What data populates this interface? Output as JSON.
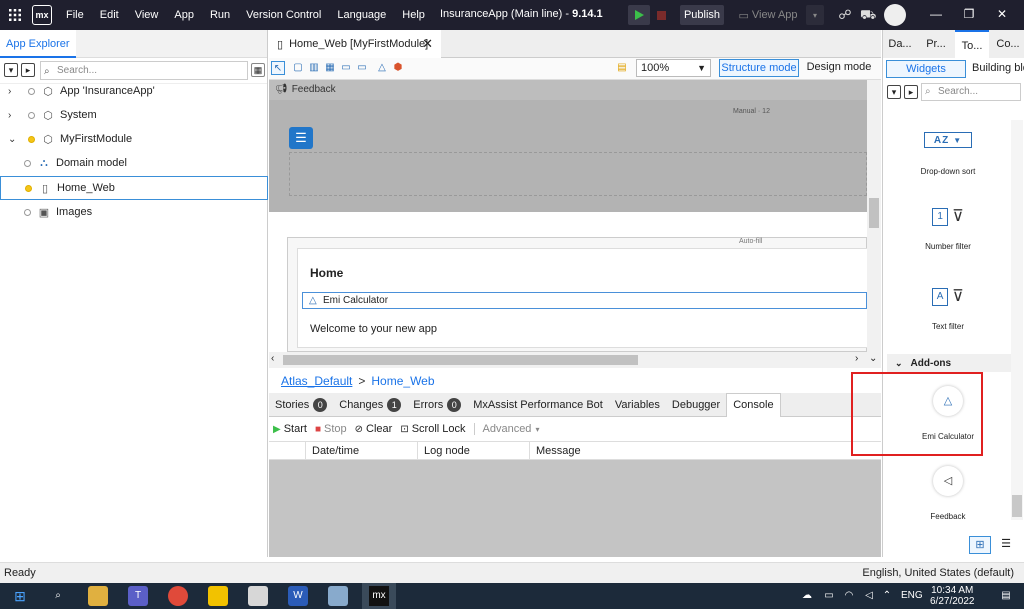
{
  "topbar": {
    "menu": [
      "File",
      "Edit",
      "View",
      "App",
      "Run",
      "Version Control",
      "Language",
      "Help"
    ],
    "app_name": "InsuranceApp (Main line)",
    "version": "9.14.1",
    "publish_label": "Publish",
    "view_app_label": "View App",
    "logo_text": "mx"
  },
  "left_panel": {
    "tab_label": "App Explorer",
    "search_placeholder": "Search...",
    "tree": [
      {
        "label": "App 'InsuranceApp'",
        "expandable": true
      },
      {
        "label": "System",
        "expandable": true
      },
      {
        "label": "MyFirstModule",
        "expandable": true,
        "expanded": true
      },
      {
        "label": "Domain model"
      },
      {
        "label": "Home_Web",
        "selected": true
      },
      {
        "label": "Images"
      }
    ]
  },
  "document": {
    "tab_label": "Home_Web [MyFirstModule]",
    "zoom": "100%",
    "structure_mode_label": "Structure mode",
    "design_mode_label": "Design mode",
    "feedback_label": "Feedback",
    "manual_label": "Manual · 12",
    "autofill_label": "Auto-fill",
    "home_title": "Home",
    "emi_label": "Emi Calculator",
    "welcome_text": "Welcome to your new app",
    "breadcrumb": [
      "Atlas_Default",
      "Home_Web"
    ],
    "breadcrumb_sep": ">"
  },
  "bottom_panel": {
    "tabs": [
      {
        "label": "Stories",
        "badge": "0"
      },
      {
        "label": "Changes",
        "badge": "1"
      },
      {
        "label": "Errors",
        "badge": "0"
      },
      {
        "label": "MxAssist Performance Bot"
      },
      {
        "label": "Variables"
      },
      {
        "label": "Debugger"
      },
      {
        "label": "Console",
        "active": true
      }
    ],
    "tools": {
      "start": "Start",
      "stop": "Stop",
      "clear": "Clear",
      "scroll_lock": "Scroll Lock",
      "advanced": "Advanced"
    },
    "columns": [
      "Date/time",
      "Log node",
      "Message"
    ]
  },
  "right_panel": {
    "tabs": [
      "Da...",
      "Pr...",
      "To...",
      "Co..."
    ],
    "widgets_label": "Widgets",
    "building_label": "Building blo",
    "search_placeholder": "Search...",
    "widgets": [
      {
        "label": "Drop-down sort",
        "icon": "AZ"
      },
      {
        "label": "Number filter",
        "icon": "1"
      },
      {
        "label": "Text filter",
        "icon": "A"
      }
    ],
    "addons_label": "Add-ons",
    "addons": [
      {
        "label": "Emi Calculator"
      },
      {
        "label": "Feedback"
      }
    ]
  },
  "statusbar": {
    "left": "Ready",
    "right": "English, United States (default)"
  },
  "taskbar": {
    "lang": "ENG",
    "time": "10:34 AM",
    "date": "6/27/2022"
  },
  "colors": {
    "accent": "#1a73e8",
    "highlight_box": "#e02020",
    "titlebar": "#1f1f2e"
  }
}
